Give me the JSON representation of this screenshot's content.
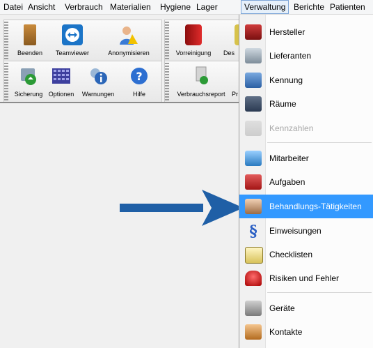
{
  "menubar": {
    "items": [
      "Datei",
      "Ansicht",
      "Verbrauch",
      "Materialien",
      "Hygiene",
      "Lager",
      "Verwaltung",
      "Berichte",
      "Patienten"
    ],
    "open_item": "Verwaltung"
  },
  "toolbar1": {
    "buttons": [
      "Beenden",
      "Teamviewer",
      "Anonymisieren",
      "Vorreinigung",
      "Des"
    ]
  },
  "toolbar2": {
    "buttons": [
      "Sicherung",
      "Optionen",
      "Warnungen",
      "Hilfe",
      "Verbrauchsreport",
      "Pr"
    ]
  },
  "verwaltung_menu": {
    "items": [
      {
        "label": "Hersteller",
        "icon": "factory-icon",
        "enabled": true
      },
      {
        "label": "Lieferanten",
        "icon": "truck-icon",
        "enabled": true
      },
      {
        "label": "Kennung",
        "icon": "tag-icon",
        "enabled": true
      },
      {
        "label": "Räume",
        "icon": "room-icon",
        "enabled": true
      },
      {
        "label": "Kennzahlen",
        "icon": "chart-icon",
        "enabled": false
      },
      {
        "label": "Mitarbeiter",
        "icon": "employee-icon",
        "enabled": true
      },
      {
        "label": "Aufgaben",
        "icon": "tasks-icon",
        "enabled": true
      },
      {
        "label": "Behandlungs-Tätigkeiten",
        "icon": "treatment-icon",
        "enabled": true,
        "highlighted": true
      },
      {
        "label": "Einweisungen",
        "icon": "paragraph-icon",
        "enabled": true
      },
      {
        "label": "Checklisten",
        "icon": "checklist-icon",
        "enabled": true
      },
      {
        "label": "Risiken und Fehler",
        "icon": "alarm-icon",
        "enabled": true
      },
      {
        "label": "Geräte",
        "icon": "device-icon",
        "enabled": true
      },
      {
        "label": "Kontakte",
        "icon": "contact-icon",
        "enabled": true
      }
    ]
  },
  "colors": {
    "highlight": "#3399ff",
    "arrow": "#1f5fa6"
  }
}
